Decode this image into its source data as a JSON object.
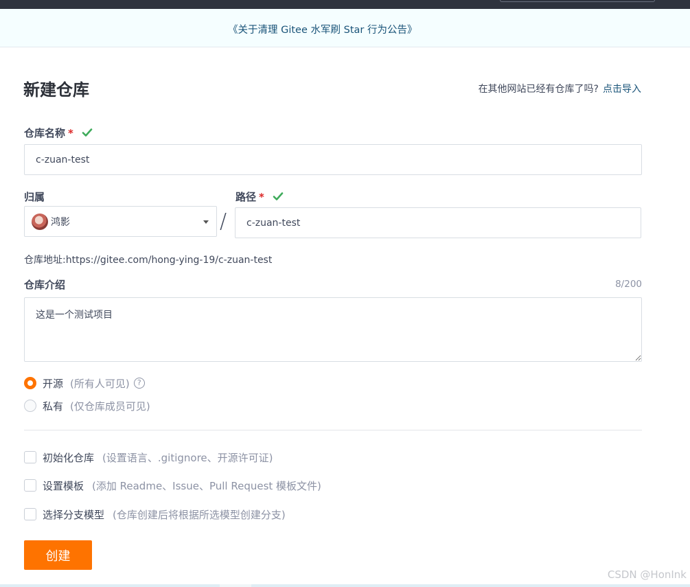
{
  "announcement": "《关于清理 Gitee 水军刷 Star 行为公告》",
  "title": "新建仓库",
  "import_hint": {
    "text": "在其他网站已经有仓库了吗?",
    "link": "点击导入"
  },
  "repo_name": {
    "label": "仓库名称",
    "required_mark": "*",
    "value": "c-zuan-test",
    "valid": true
  },
  "owner": {
    "label": "归属",
    "value": "鸿影"
  },
  "separator": "/",
  "path": {
    "label": "路径",
    "required_mark": "*",
    "value": "c-zuan-test",
    "valid": true
  },
  "repo_address": "仓库地址:https://gitee.com/hong-ying-19/c-zuan-test",
  "description": {
    "label": "仓库介绍",
    "counter": "8/200",
    "value": "这是一个测试项目"
  },
  "visibility": [
    {
      "label": "开源",
      "note": "(所有人可见)",
      "selected": true,
      "help": "?"
    },
    {
      "label": "私有",
      "note": "(仅仓库成员可见)",
      "selected": false
    }
  ],
  "options": [
    {
      "label": "初始化仓库",
      "note": "(设置语言、.gitignore、开源许可证)",
      "checked": false
    },
    {
      "label": "设置模板",
      "note": "(添加 Readme、Issue、Pull Request 模板文件)",
      "checked": false
    },
    {
      "label": "选择分支模型",
      "note": "(仓库创建后将根据所选模型创建分支)",
      "checked": false
    }
  ],
  "create_button": "创建",
  "watermark": "CSDN @HonInk",
  "colors": {
    "accent": "#fe7300",
    "link": "#1a5479",
    "valid": "#3fab5b",
    "required": "#db2828"
  }
}
